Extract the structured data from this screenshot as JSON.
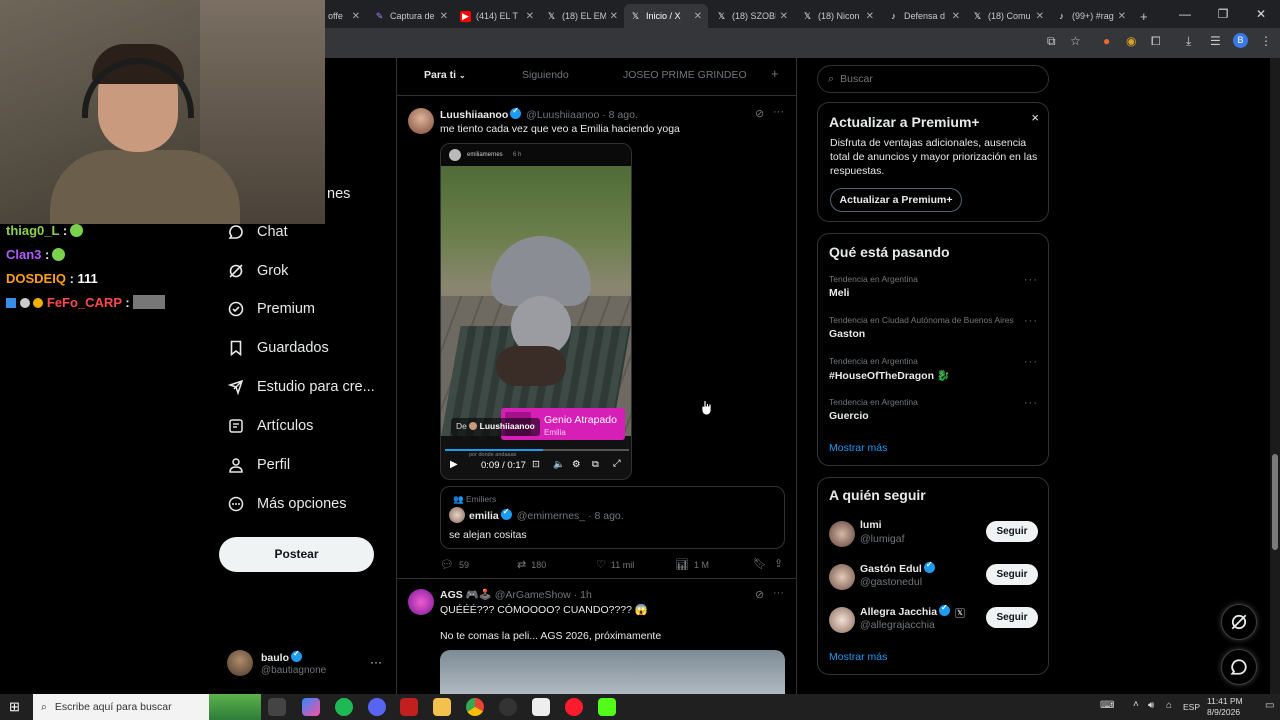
{
  "browser": {
    "tabs": [
      {
        "title": "offe",
        "icon": "youtube-like"
      },
      {
        "title": "Captura de",
        "icon": "pen-icon"
      },
      {
        "title": "(414) EL T",
        "icon": "youtube-icon"
      },
      {
        "title": "(18) EL EM",
        "icon": "x-icon"
      },
      {
        "title": "Inicio / X",
        "icon": "x-icon"
      },
      {
        "title": "(18) SZOBI",
        "icon": "x-icon"
      },
      {
        "title": "(18) Nicon",
        "icon": "x-icon"
      },
      {
        "title": "Defensa d",
        "icon": "tiktok-icon"
      },
      {
        "title": "(18) Comu",
        "icon": "x-icon"
      },
      {
        "title": "(99+) #rag",
        "icon": "tiktok-icon"
      }
    ],
    "new_tab": "+",
    "profile_initial": "B"
  },
  "stream_chat": [
    {
      "user": "thiag0_L",
      "color": "#8fd14f",
      "message": ""
    },
    {
      "user": "Clan3",
      "color": "#b05cff",
      "message": ""
    },
    {
      "user": "DOSDEIQ",
      "color": "#ff9f1a",
      "message": "111"
    },
    {
      "user": "FeFo_CARP",
      "color": "#ff4a4a",
      "message": ""
    }
  ],
  "sidebar": {
    "partial_label": "nes",
    "items": [
      {
        "label": "Chat",
        "icon": "chat-icon"
      },
      {
        "label": "Grok",
        "icon": "grok-icon"
      },
      {
        "label": "Premium",
        "icon": "premium-icon"
      },
      {
        "label": "Guardados",
        "icon": "bookmark-icon"
      },
      {
        "label": "Estudio para cre...",
        "icon": "rocket-icon"
      },
      {
        "label": "Artículos",
        "icon": "article-icon"
      },
      {
        "label": "Perfil",
        "icon": "profile-icon"
      },
      {
        "label": "Más opciones",
        "icon": "more-options-icon"
      }
    ],
    "post_button": "Postear",
    "account": {
      "name": "baulo",
      "handle": "@bautiagnone"
    }
  },
  "timeline": {
    "tabs": [
      "Para ti",
      "Siguiendo",
      "JOSEO PRIME GRINDEO"
    ],
    "add_tab": "+",
    "posts": [
      {
        "author": "Luushiiaanoo",
        "handle": "@Luushiiaanoo",
        "time": "· 8 ago.",
        "text": "me tiento cada vez que veo a Emilia haciendo yoga",
        "media": {
          "story_user": "emiliamernes",
          "story_time": "6 h",
          "from_label": "De",
          "from_user": "Luushiiaanoo",
          "song": "Genio Atrapado",
          "artist": "Emilia",
          "caption": "por donde andaaas",
          "time_current": "0:09",
          "time_total": "0:17",
          "progress": 0.53
        },
        "quote": {
          "community": "Emiliers",
          "author": "emilia",
          "handle": "@emimernes_",
          "time": "· 8 ago.",
          "text": "se alejan cositas"
        },
        "stats": {
          "replies": "59",
          "reposts": "180",
          "likes": "11 mil",
          "views": "1 M"
        }
      },
      {
        "author": "AGS 🎮🕹️",
        "handle": "@ArGameShow",
        "time": "· 1h",
        "text": "QUÉÉÉ??? CÓMOOOO? CUANDO???? 😱",
        "text2": "No te comas la peli... AGS 2026, próximamente"
      }
    ]
  },
  "right": {
    "search_placeholder": "Buscar",
    "premium": {
      "title": "Actualizar a Premium+",
      "body": "Disfruta de ventajas adicionales, ausencia total de anuncios y mayor priorización en las respuestas.",
      "button": "Actualizar a Premium+",
      "close": "×"
    },
    "trends_title": "Qué está pasando",
    "trends": [
      {
        "category": "Tendencia en Argentina",
        "name": "Meli"
      },
      {
        "category": "Tendencia en Ciudad Autónoma de Buenos Aires",
        "name": "Gaston"
      },
      {
        "category": "Tendencia en Argentina",
        "name": "#HouseOfTheDragon 🐉"
      },
      {
        "category": "Tendencia en Argentina",
        "name": "Guercio"
      }
    ],
    "show_more": "Mostrar más",
    "follow_title": "A quién seguir",
    "who_to_follow": [
      {
        "name": "lumi",
        "handle": "@lumigaf",
        "verified": false
      },
      {
        "name": "Gastón Edul",
        "handle": "@gastonedul",
        "verified": true
      },
      {
        "name": "Allegra Jacchia",
        "handle": "@allegrajacchia",
        "verified": true
      }
    ],
    "follow_button": "Seguir",
    "show_more2": "Mostrar más"
  },
  "taskbar": {
    "search_placeholder": "Escribe aquí para buscar",
    "lang": "ESP",
    "time": "11:41 PM",
    "date": "8/9/2026"
  }
}
